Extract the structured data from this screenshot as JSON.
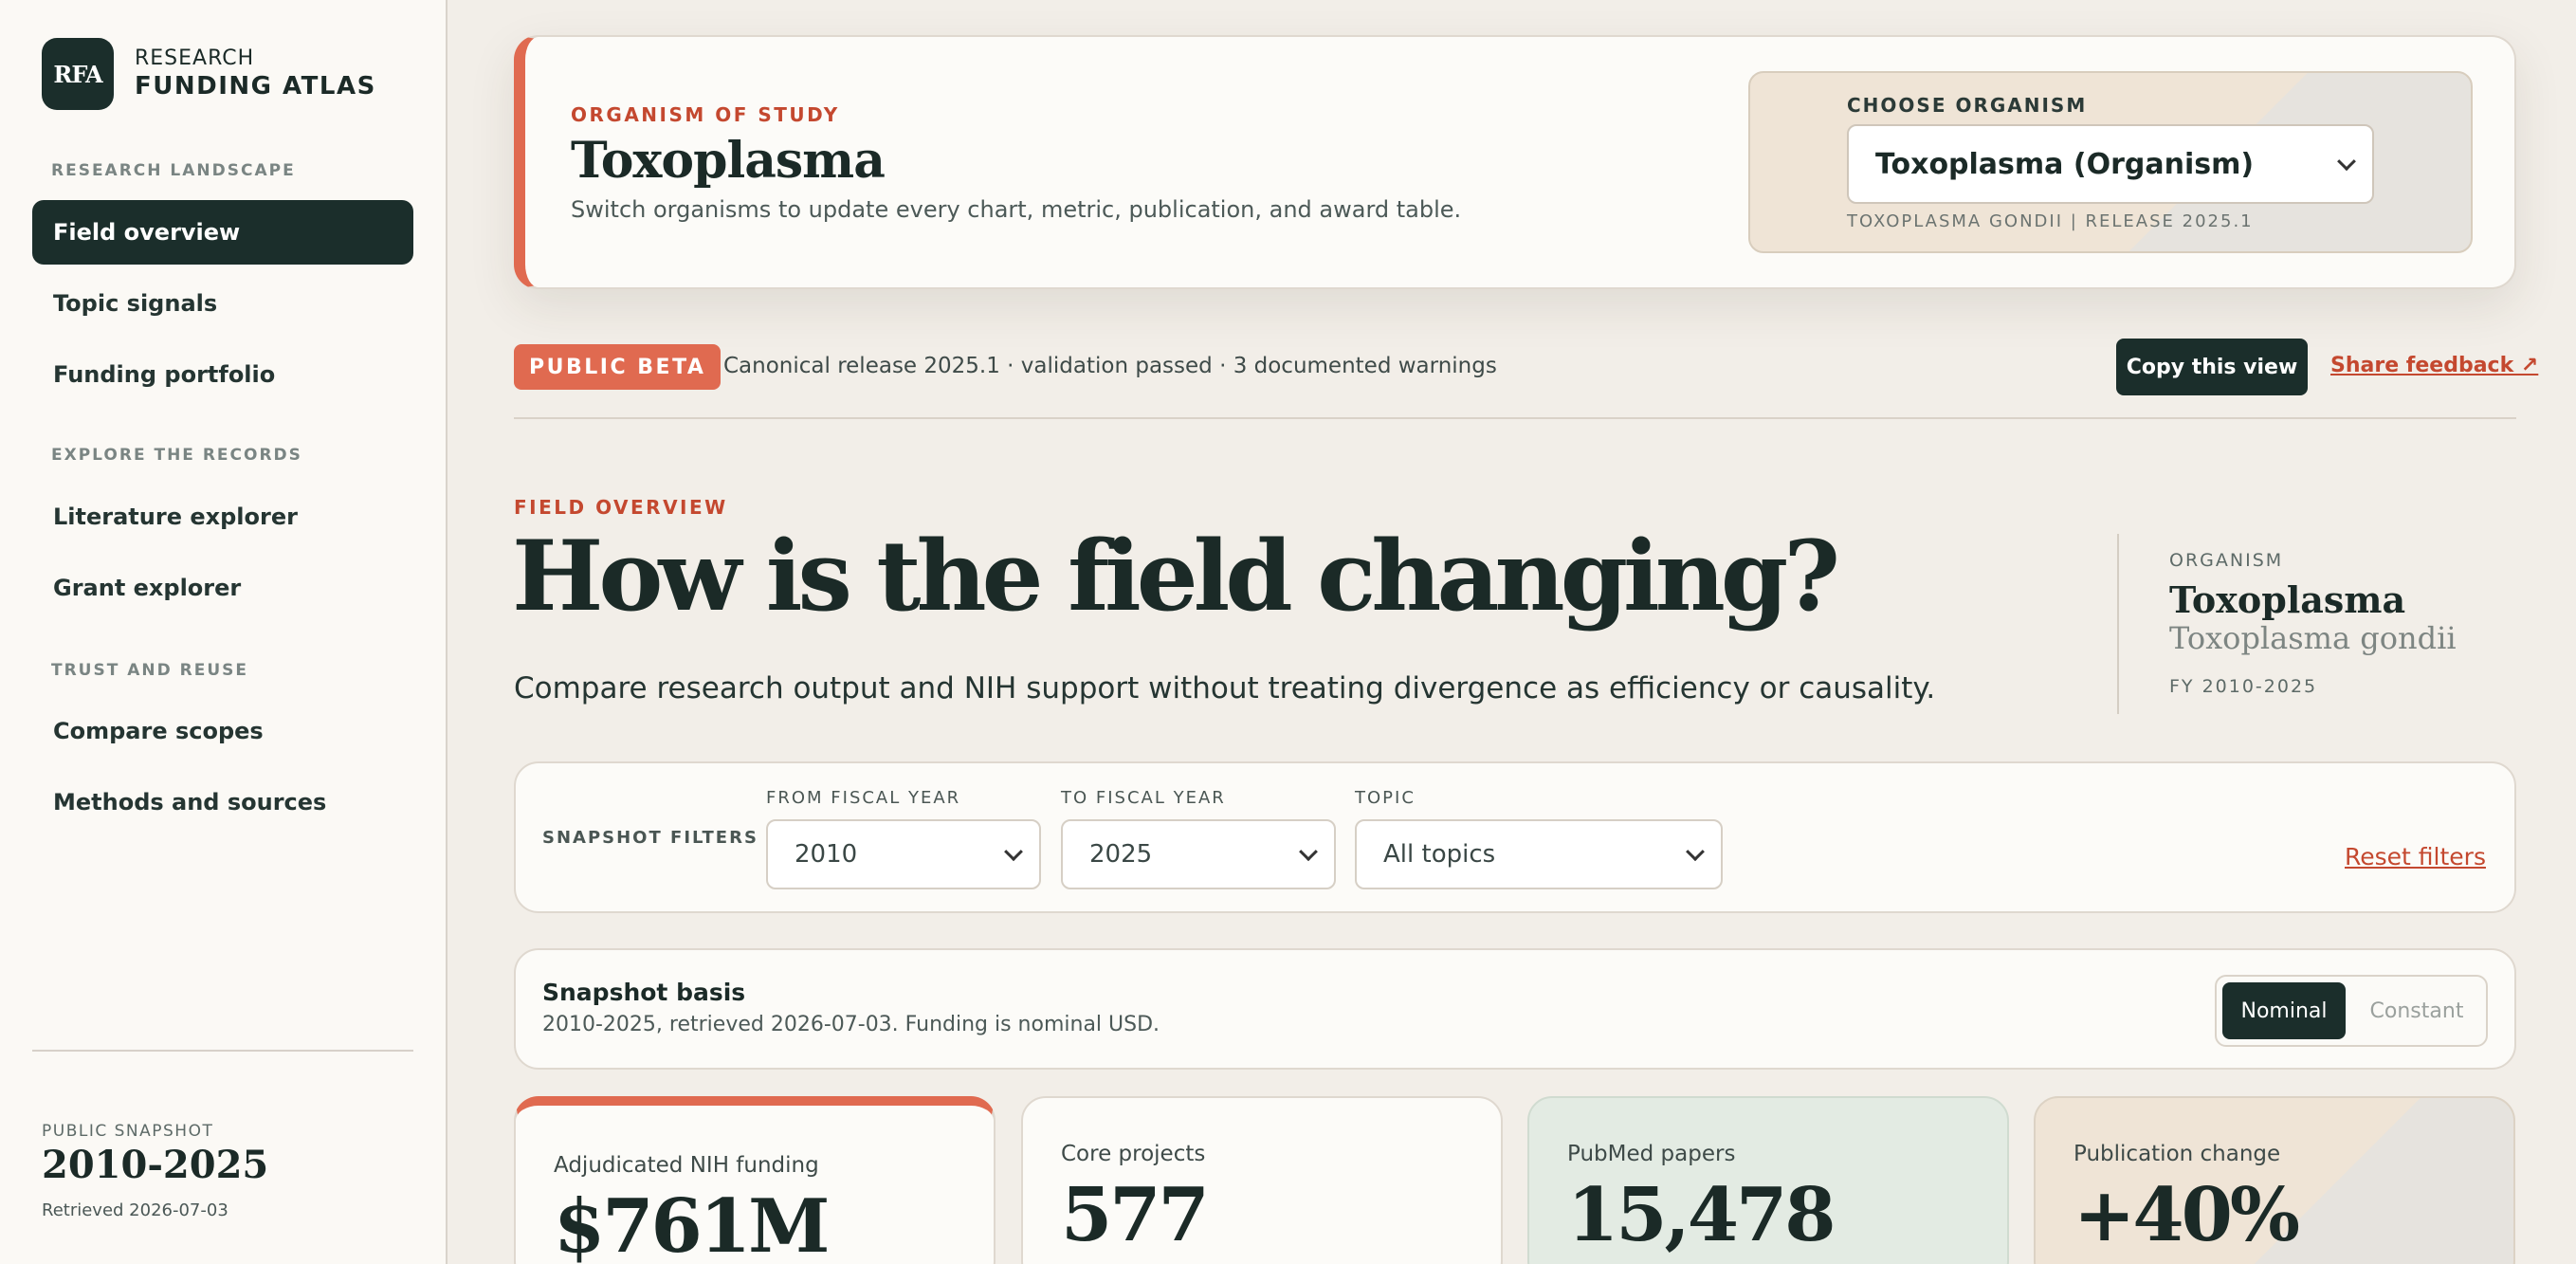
{
  "brand": {
    "logo": "RFA",
    "line1": "RESEARCH",
    "line2": "FUNDING ATLAS"
  },
  "nav": {
    "sections": [
      {
        "title": "RESEARCH LANDSCAPE",
        "items": [
          "Field overview",
          "Topic signals",
          "Funding portfolio"
        ]
      },
      {
        "title": "EXPLORE THE RECORDS",
        "items": [
          "Literature explorer",
          "Grant explorer"
        ]
      },
      {
        "title": "TRUST AND REUSE",
        "items": [
          "Compare scopes",
          "Methods and sources"
        ]
      }
    ],
    "active": "Field overview"
  },
  "snapshot": {
    "label": "PUBLIC SNAPSHOT",
    "range": "2010-2025",
    "retrieved": "Retrieved 2026-07-03"
  },
  "hero": {
    "eyebrow": "ORGANISM OF STUDY",
    "title": "Toxoplasma",
    "subtitle": "Switch organisms to update every chart, metric, publication, and award table.",
    "chooser_label": "CHOOSE ORGANISM",
    "chooser_value": "Toxoplasma (Organism)",
    "chooser_meta": "TOXOPLASMA GONDII | RELEASE 2025.1"
  },
  "beta": {
    "badge": "PUBLIC BETA",
    "text": "Canonical release 2025.1 · validation passed · 3 documented warnings",
    "copy_button": "Copy this view",
    "feedback_link": "Share feedback ↗"
  },
  "overview": {
    "eyebrow": "FIELD OVERVIEW",
    "title": "How is the field changing?",
    "subtitle": "Compare research output and NIH support without treating divergence as efficiency or causality.",
    "org_label": "ORGANISM",
    "org_name": "Toxoplasma",
    "org_species": "Toxoplasma gondii",
    "org_fy": "FY 2010-2025"
  },
  "filters": {
    "title": "SNAPSHOT FILTERS",
    "from_label": "FROM FISCAL YEAR",
    "from_value": "2010",
    "to_label": "TO FISCAL YEAR",
    "to_value": "2025",
    "topic_label": "TOPIC",
    "topic_value": "All topics",
    "reset": "Reset filters"
  },
  "basis": {
    "title": "Snapshot basis",
    "subtitle": "2010-2025, retrieved 2026-07-03. Funding is nominal USD.",
    "toggle_on": "Nominal",
    "toggle_off": "Constant"
  },
  "metrics": [
    {
      "label": "Adjudicated NIH funding",
      "value": "$761M"
    },
    {
      "label": "Core projects",
      "value": "577"
    },
    {
      "label": "PubMed papers",
      "value": "15,478"
    },
    {
      "label": "Publication change",
      "value": "+40%"
    }
  ],
  "colors": {
    "accent": "#e06a50",
    "dark": "#1b2e2b",
    "link": "#c4482f"
  }
}
